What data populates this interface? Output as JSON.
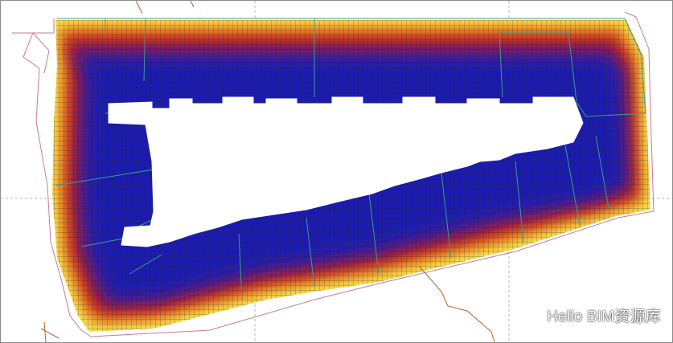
{
  "watermark": {
    "text": "Hello BIM资源库",
    "icon": "wechat-icon"
  },
  "colors": {
    "background": "#ffffff",
    "frame": "#8c8c8c",
    "guide_line": "#b4b4b4",
    "outline_pink": "#c77a9a",
    "outline_teal": "#3a9e8f",
    "outline_brown": "#b5652e",
    "grid_line": "#1c1c1c",
    "color_scale": [
      "#1a1fb0",
      "#3b1fa6",
      "#7a1a72",
      "#b8191f",
      "#e0341a",
      "#ee7d15",
      "#f8c62a",
      "#f8ec55"
    ]
  }
}
